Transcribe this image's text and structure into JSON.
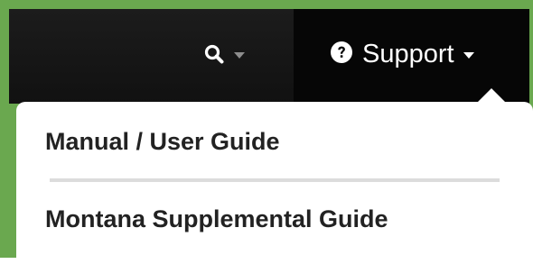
{
  "colors": {
    "frame": "#6aa84f",
    "navbar": "#141414",
    "support_tab": "#060606",
    "dropdown_bg": "#ffffff",
    "menu_text": "#222222",
    "divider": "#dcdcdc"
  },
  "navbar": {
    "search": {
      "icon": "search-icon",
      "caret_icon": "caret-down-icon"
    },
    "support": {
      "icon": "question-circle-icon",
      "label": "Support",
      "caret_icon": "caret-down-icon"
    }
  },
  "dropdown": {
    "items": [
      {
        "label": "Manual / User Guide"
      },
      {
        "label": "Montana Supplemental Guide"
      }
    ]
  }
}
